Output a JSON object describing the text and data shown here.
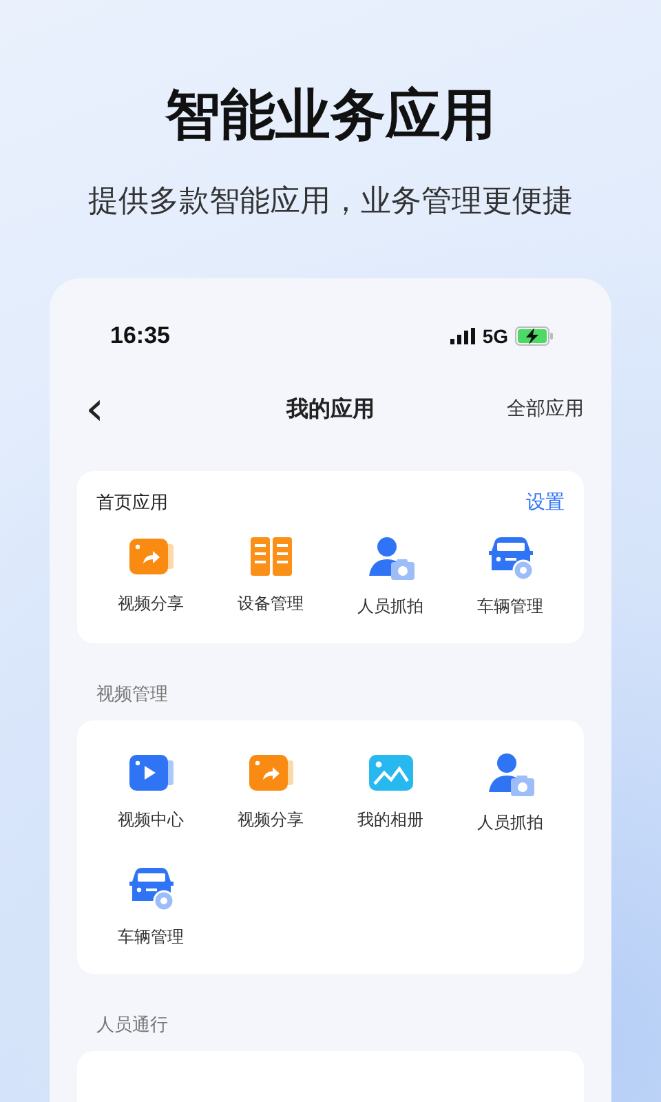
{
  "headline": "智能业务应用",
  "subtitle": "提供多款智能应用，业务管理更便捷",
  "status_bar": {
    "time": "16:35",
    "network": "5G"
  },
  "nav": {
    "back": "‹",
    "title": "我的应用",
    "action": "全部应用"
  },
  "home_apps": {
    "title": "首页应用",
    "action": "设置",
    "items": [
      {
        "label": "视频分享",
        "kind": "share"
      },
      {
        "label": "设备管理",
        "kind": "device"
      },
      {
        "label": "人员抓拍",
        "kind": "person"
      },
      {
        "label": "车辆管理",
        "kind": "car"
      }
    ]
  },
  "sections": [
    {
      "title": "视频管理",
      "items": [
        {
          "label": "视频中心",
          "kind": "video"
        },
        {
          "label": "视频分享",
          "kind": "share"
        },
        {
          "label": "我的相册",
          "kind": "album"
        },
        {
          "label": "人员抓拍",
          "kind": "person"
        },
        {
          "label": "车辆管理",
          "kind": "car"
        }
      ]
    },
    {
      "title": "人员通行"
    }
  ]
}
